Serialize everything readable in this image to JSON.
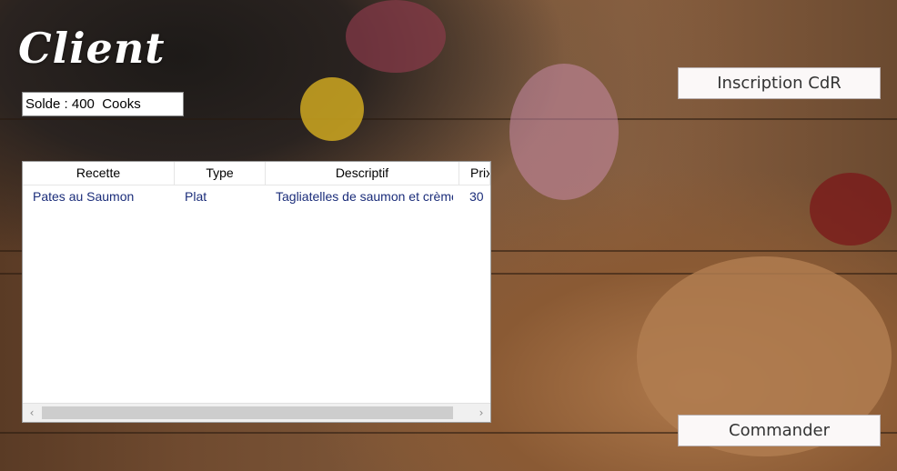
{
  "title": "Client",
  "balance_text": "Solde : 400  Cooks",
  "buttons": {
    "register": "Inscription CdR",
    "order": "Commander"
  },
  "table": {
    "columns": [
      "Recette",
      "Type",
      "Descriptif",
      "Prix"
    ],
    "rows": [
      [
        "Pates au Saumon",
        "Plat",
        "Tagliatelles de saumon et crème",
        "30"
      ]
    ]
  },
  "scroll_left_glyph": "‹",
  "scroll_right_glyph": "›"
}
